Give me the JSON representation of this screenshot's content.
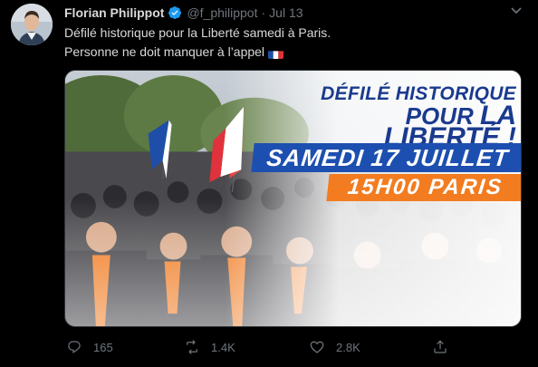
{
  "tweet": {
    "author_name": "Florian Philippot",
    "handle": "@f_philippot",
    "separator": "·",
    "date": "Jul 13",
    "text_line1": "Défilé historique pour la Liberté samedi à Paris.",
    "text_line2": "Personne ne doit manquer à l’appel",
    "media": {
      "title_line1": "DÉFILÉ HISTORIQUE",
      "title_line2_prefix": "POUR",
      "title_line2_main": "LA LIBERTÉ !",
      "date_banner": "SAMEDI 17 JUILLET",
      "time_banner": "15H00  PARIS"
    },
    "actions": {
      "replies": "165",
      "retweets": "1.4K",
      "likes": "2.8K"
    }
  },
  "colors": {
    "background": "#000000",
    "text": "#d9d9d9",
    "muted": "#6e767d",
    "verified": "#1d9bf0",
    "banner_blue": "#1d4fb0",
    "banner_orange": "#f27c1f",
    "title_blue": "#1a3a8f"
  },
  "icons": [
    "verified-badge-icon",
    "chevron-down-icon",
    "reply-icon",
    "retweet-icon",
    "like-icon",
    "share-icon",
    "french-flag-icon"
  ]
}
